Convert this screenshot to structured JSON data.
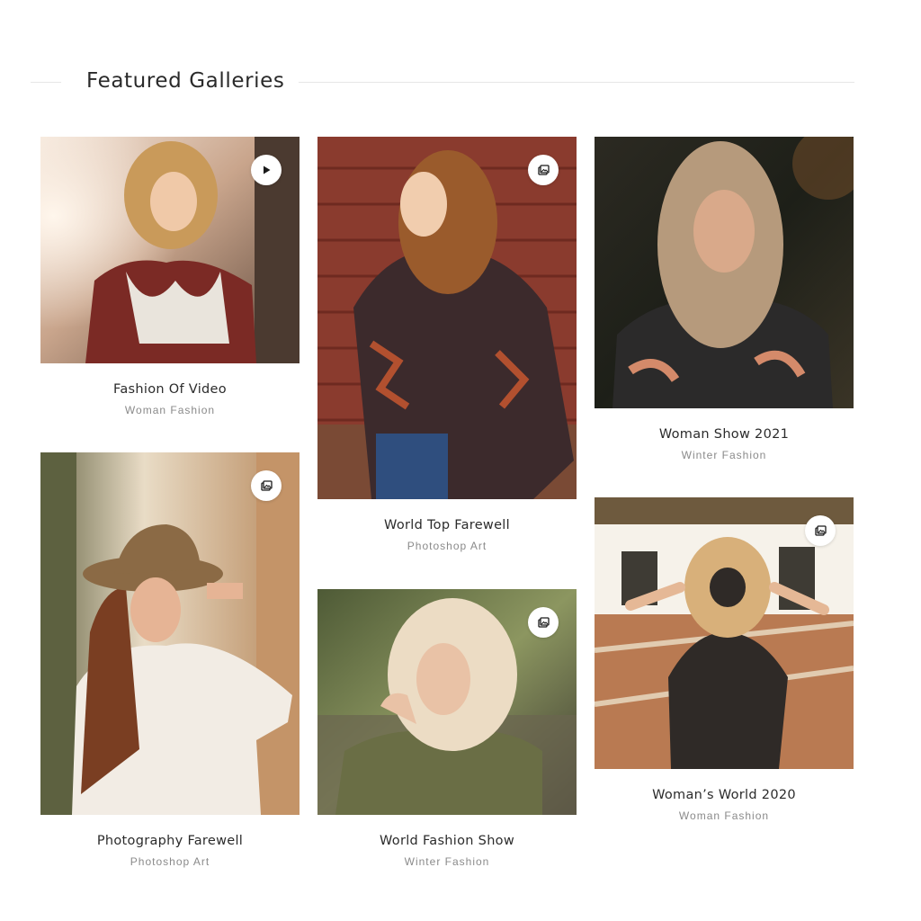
{
  "section": {
    "title": "Featured Galleries"
  },
  "galleries": [
    {
      "title": "Fashion Of Video",
      "category": "Woman Fashion",
      "media_icon": "play-icon",
      "photo": "woman with scarf in sunlight beside tree"
    },
    {
      "title": "World Top Farewell",
      "category": "Photoshop Art",
      "media_icon": "gallery-icon",
      "photo": "smiling woman in patterned poncho against red wooden wall"
    },
    {
      "title": "Woman Show 2021",
      "category": "Winter Fashion",
      "media_icon": "gallery-icon",
      "photo": "woman with blonde ombre hair in front of dark foliage"
    },
    {
      "title": "Photography Farewell",
      "category": "Photoshop Art",
      "media_icon": "gallery-icon",
      "photo": "woman in brown hat and white blouse in street"
    },
    {
      "title": "World Fashion Show",
      "category": "Winter Fashion",
      "media_icon": "gallery-icon",
      "photo": "blonde woman in olive jacket outdoors"
    },
    {
      "title": "Woman’s World 2020",
      "category": "Woman Fashion",
      "media_icon": "gallery-icon",
      "photo": "woman in straw hat and floral dress in courtyard"
    }
  ],
  "colors": {
    "title": "#2b2b2b",
    "subtitle": "#8a8a8a",
    "divider": "#e6e6e6",
    "badge_bg": "#ffffff"
  }
}
